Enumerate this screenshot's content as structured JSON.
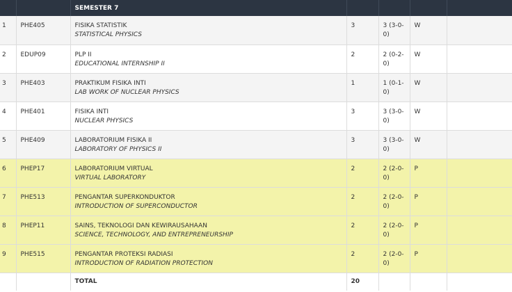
{
  "header": {
    "semester": "SEMESTER 7"
  },
  "rows": [
    {
      "no": "1",
      "code": "PHE405",
      "name_id": "FISIKA STATISTIK",
      "name_en": "STATISTICAL PHYSICS",
      "credit": "3",
      "credit_detail": "3 (3-0-0)",
      "type": "W"
    },
    {
      "no": "2",
      "code": "EDUP09",
      "name_id": "PLP II",
      "name_en": "EDUCATIONAL INTERNSHIP II",
      "credit": "2",
      "credit_detail": "2 (0-2-0)",
      "type": "W"
    },
    {
      "no": "3",
      "code": "PHE403",
      "name_id": "PRAKTIKUM FISIKA INTI",
      "name_en": "LAB WORK OF NUCLEAR PHYSICS",
      "credit": "1",
      "credit_detail": "1 (0-1-0)",
      "type": "W"
    },
    {
      "no": "4",
      "code": "PHE401",
      "name_id": "FISIKA INTI",
      "name_en": "NUCLEAR PHYSICS",
      "credit": "3",
      "credit_detail": "3 (3-0-0)",
      "type": "W"
    },
    {
      "no": "5",
      "code": "PHE409",
      "name_id": "LABORATORIUM FISIKA II",
      "name_en": "LABORATORY OF PHYSICS II",
      "credit": "3",
      "credit_detail": "3 (3-0-0)",
      "type": "W"
    },
    {
      "no": "6",
      "code": "PHEP17",
      "name_id": "LABORATORIUM VIRTUAL",
      "name_en": "VIRTUAL LABORATORY",
      "credit": "2",
      "credit_detail": "2 (2-0-0)",
      "type": "P"
    },
    {
      "no": "7",
      "code": "PHE513",
      "name_id": "PENGANTAR SUPERKONDUKTOR",
      "name_en": "INTRODUCTION OF SUPERCONDUCTOR",
      "credit": "2",
      "credit_detail": "2 (2-0-0)",
      "type": "P"
    },
    {
      "no": "8",
      "code": "PHEP11",
      "name_id": "SAINS, TEKNOLOGI DAN KEWIRAUSAHAAN",
      "name_en": "SCIENCE, TECHNOLOGY, AND ENTREPRENEURSHIP",
      "credit": "2",
      "credit_detail": "2 (2-0-0)",
      "type": "P"
    },
    {
      "no": "9",
      "code": "PHE515",
      "name_id": "PENGANTAR PROTEKSI RADIASI",
      "name_en": "INTRODUCTION OF RADIATION PROTECTION",
      "credit": "2",
      "credit_detail": "2 (2-0-0)",
      "type": "P"
    }
  ],
  "total": {
    "label": "TOTAL",
    "value": "20"
  },
  "colors": {
    "header_bg": "#2c3542",
    "wajib_bg": "#f4f4f4",
    "pilihan_bg": "#f3f3aa"
  }
}
